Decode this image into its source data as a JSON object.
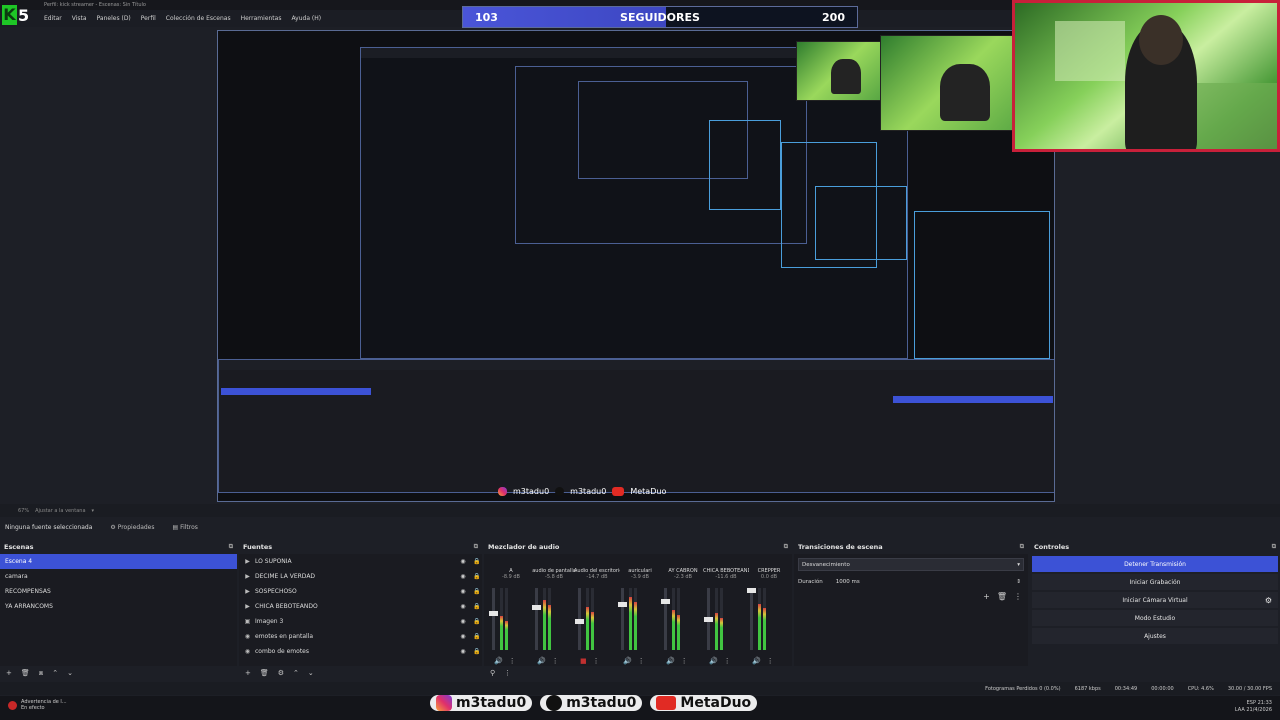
{
  "window": {
    "title": "Perfil: kick streamer - Escenas: Sin Título"
  },
  "menu": [
    "Editar",
    "Vista",
    "Paneles (D)",
    "Perfil",
    "Colección de Escenas",
    "Herramientas",
    "Ayuda (H)"
  ],
  "brand": {
    "logo_letter": "K",
    "logo_number": "5"
  },
  "followers": {
    "current": "103",
    "label": "SEGUIDORES",
    "goal": "200",
    "progress": 0.515
  },
  "preview": {
    "zoom": "67%",
    "zoom_label": "Ajustar a la ventana"
  },
  "selection": {
    "none_selected": "Ninguna fuente seleccionada",
    "properties": "Propiedades",
    "filters": "Filtros"
  },
  "scenes": {
    "title": "Escenas",
    "items": [
      "Escena 4",
      "camara",
      "RECOMPENSAS",
      "YA ARRANCOMS"
    ],
    "active_index": 0
  },
  "sources": {
    "title": "Fuentes",
    "items": [
      {
        "label": "LO SUPONIA",
        "type": "folder"
      },
      {
        "label": "DECIME LA VERDAD",
        "type": "folder"
      },
      {
        "label": "SOSPECHOSO",
        "type": "folder"
      },
      {
        "label": "CHICA BEBOTEANDO",
        "type": "folder"
      },
      {
        "label": "Imagen 3",
        "type": "image"
      },
      {
        "label": "emotes en pantalla",
        "type": "browser"
      },
      {
        "label": "combo de emotes",
        "type": "browser"
      }
    ]
  },
  "mixer": {
    "title": "Mezclador de audio",
    "channels": [
      {
        "name": "A",
        "db": "-8.9 dB",
        "fader": 0.6,
        "level": 0.55,
        "muted": false
      },
      {
        "name": "audio de pantalla",
        "db": "-5.8 dB",
        "fader": 0.7,
        "level": 0.8,
        "muted": false
      },
      {
        "name": "Audio del escritorio",
        "db": "-14.7 dB",
        "fader": 0.45,
        "level": 0.7,
        "muted": true
      },
      {
        "name": "auriculari",
        "db": "-3.9 dB",
        "fader": 0.75,
        "level": 0.85,
        "muted": false
      },
      {
        "name": "AY CABRON",
        "db": "-2.3 dB",
        "fader": 0.8,
        "level": 0.65,
        "muted": false
      },
      {
        "name": "CHICA BEBOTEANDO",
        "db": "-11.6 dB",
        "fader": 0.5,
        "level": 0.6,
        "muted": false
      },
      {
        "name": "CREPPER",
        "db": "0.0 dB",
        "fader": 1.0,
        "level": 0.75,
        "muted": false
      }
    ]
  },
  "transitions": {
    "title": "Transiciones de escena",
    "type": "Desvanecimiento",
    "duration_label": "Duración",
    "duration_value": "1000 ms"
  },
  "controls": {
    "title": "Controles",
    "buttons": [
      "Detener Transmisión",
      "Iniciar Grabación",
      "Iniciar Cámara Virtual",
      "Modo Estudio",
      "Ajustes"
    ]
  },
  "status": {
    "dropped": "Fotogramas Perdidos 0 (0.0%)",
    "bitrate": "6187 kbps",
    "live_time": "00:34:49",
    "rec_time": "00:00:00",
    "cpu": "CPU: 4.6%",
    "fps": "30.00 / 30.00 FPS"
  },
  "social": {
    "instagram": "m3tadu0",
    "tiktok": "m3tadu0",
    "youtube": "MetaDuo"
  },
  "taskbar": {
    "app_title": "Advertencia de l...",
    "app_sub": "En efecto",
    "lang": "ESP",
    "region": "LAA",
    "time": "21:33",
    "date": "21/4/2026"
  },
  "colors": {
    "accent": "#3c52d6",
    "webcam_border": "#c8203a",
    "meter_green": "#41c541"
  }
}
